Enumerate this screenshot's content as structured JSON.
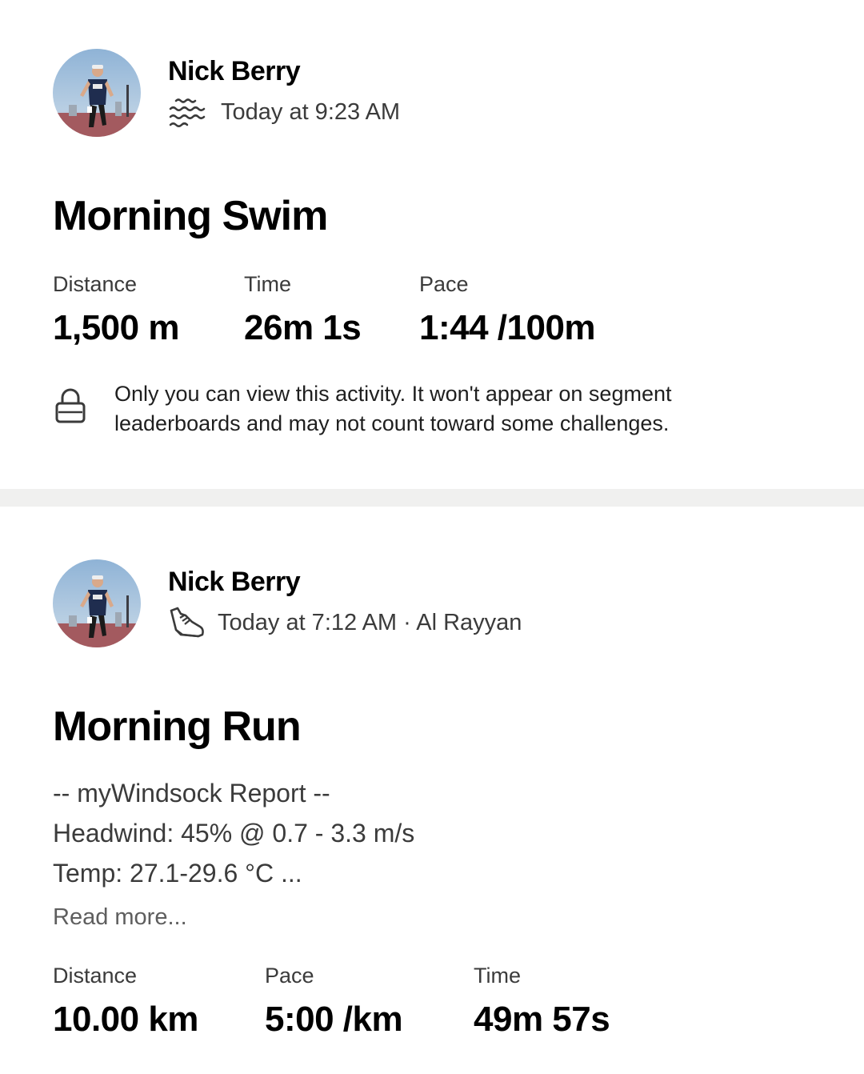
{
  "activities": [
    {
      "athlete": "Nick Berry",
      "sport_icon": "swim-waves-icon",
      "meta": "Today at 9:23 AM",
      "title": "Morning Swim",
      "stats": [
        {
          "label": "Distance",
          "value": "1,500 m"
        },
        {
          "label": "Time",
          "value": "26m 1s"
        },
        {
          "label": "Pace",
          "value": "1:44 /100m"
        }
      ],
      "privacy_notice": "Only you can view this activity. It won't appear on segment leaderboards and may not count toward some challenges."
    },
    {
      "athlete": "Nick Berry",
      "sport_icon": "running-shoe-icon",
      "meta": "Today at 7:12 AM · Al Rayyan",
      "title": "Morning Run",
      "description": [
        "-- myWindsock Report --",
        "Headwind: 45% @ 0.7 - 3.3 m/s",
        "Temp: 27.1-29.6 °C ..."
      ],
      "read_more": "Read more...",
      "stats": [
        {
          "label": "Distance",
          "value": "10.00 km"
        },
        {
          "label": "Pace",
          "value": "5:00 /km"
        },
        {
          "label": "Time",
          "value": "49m 57s"
        }
      ]
    }
  ],
  "colors": {
    "background": "#ffffff",
    "divider": "#f0f0ef",
    "text_primary": "#000000",
    "text_secondary": "#3b3b3b"
  }
}
